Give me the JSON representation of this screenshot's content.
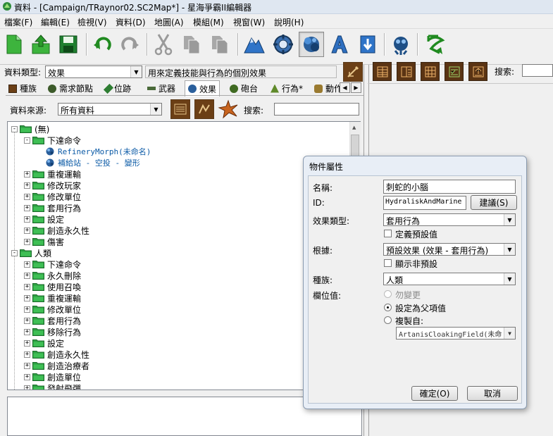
{
  "window": {
    "title": "資料 - [Campaign/TRaynor02.SC2Map*] - 星海爭霸II編輯器"
  },
  "menu": [
    "檔案(F)",
    "編輯(E)",
    "檢視(V)",
    "資料(D)",
    "地圖(A)",
    "模組(M)",
    "視窗(W)",
    "說明(H)"
  ],
  "toolbar": {
    "icons": [
      "new-file-icon",
      "open-upload-icon",
      "save-icon",
      "undo-icon",
      "redo-icon",
      "cut-icon",
      "copy-icon",
      "paste-icon",
      "terrain-editor-icon",
      "trigger-editor-icon",
      "data-editor-icon",
      "text-editor-icon",
      "import-icon",
      "ai-editor-icon",
      "test-map-icon"
    ]
  },
  "data_type": {
    "label": "資料類型:",
    "value": "效果",
    "description": "用來定義技能與行為的個別效果"
  },
  "tabs": [
    {
      "label": "種族",
      "icon": "race-icon"
    },
    {
      "label": "需求節點",
      "icon": "requirement-node-icon"
    },
    {
      "label": "位跡",
      "icon": "footprint-icon"
    },
    {
      "label": "武器",
      "icon": "weapon-icon"
    },
    {
      "label": "效果",
      "icon": "effect-icon"
    },
    {
      "label": "砲台",
      "icon": "turret-icon"
    },
    {
      "label": "行為*",
      "icon": "behavior-icon"
    },
    {
      "label": "動作",
      "icon": "actor-icon"
    }
  ],
  "data_source": {
    "label": "資料來源:",
    "value": "所有資料",
    "search_label": "搜索:"
  },
  "tree": [
    {
      "text": "(無)",
      "level": 0,
      "expander": "-",
      "type": "folder"
    },
    {
      "text": "下達命令",
      "level": 1,
      "expander": "-",
      "type": "folder"
    },
    {
      "text": "RefineryMorph(未命名)",
      "level": 2,
      "expander": "",
      "type": "leaf"
    },
    {
      "text": "補給站 - 空投 - 變形",
      "level": 2,
      "expander": "",
      "type": "leaf"
    },
    {
      "text": "重複運輸",
      "level": 1,
      "expander": "+",
      "type": "folder"
    },
    {
      "text": "修改玩家",
      "level": 1,
      "expander": "+",
      "type": "folder"
    },
    {
      "text": "修改單位",
      "level": 1,
      "expander": "+",
      "type": "folder"
    },
    {
      "text": "套用行為",
      "level": 1,
      "expander": "+",
      "type": "folder"
    },
    {
      "text": "設定",
      "level": 1,
      "expander": "+",
      "type": "folder"
    },
    {
      "text": "創造永久性",
      "level": 1,
      "expander": "+",
      "type": "folder"
    },
    {
      "text": "傷害",
      "level": 1,
      "expander": "+",
      "type": "folder"
    },
    {
      "text": "人類",
      "level": 0,
      "expander": "-",
      "type": "folder"
    },
    {
      "text": "下達命令",
      "level": 1,
      "expander": "+",
      "type": "folder"
    },
    {
      "text": "永久刪除",
      "level": 1,
      "expander": "+",
      "type": "folder"
    },
    {
      "text": "使用召喚",
      "level": 1,
      "expander": "+",
      "type": "folder"
    },
    {
      "text": "重複運輸",
      "level": 1,
      "expander": "+",
      "type": "folder"
    },
    {
      "text": "修改單位",
      "level": 1,
      "expander": "+",
      "type": "folder"
    },
    {
      "text": "套用行為",
      "level": 1,
      "expander": "+",
      "type": "folder"
    },
    {
      "text": "移除行為",
      "level": 1,
      "expander": "+",
      "type": "folder"
    },
    {
      "text": "設定",
      "level": 1,
      "expander": "+",
      "type": "folder"
    },
    {
      "text": "創造永久性",
      "level": 1,
      "expander": "+",
      "type": "folder"
    },
    {
      "text": "創造治療者",
      "level": 1,
      "expander": "+",
      "type": "folder"
    },
    {
      "text": "創造單位",
      "level": 1,
      "expander": "+",
      "type": "folder"
    },
    {
      "text": "發射飛彈",
      "level": 1,
      "expander": "+",
      "type": "folder"
    }
  ],
  "right_panel": {
    "search_label": "搜索:"
  },
  "dialog": {
    "title": "物件屬性",
    "name_label": "名稱:",
    "name_value": "刺蛇的小腦",
    "id_label": "ID:",
    "id_value": "HydraliskAndMarine",
    "suggest_button": "建議(S)",
    "effect_type_label": "效果類型:",
    "effect_type_value": "套用行為",
    "define_default_label": "定義預設值",
    "based_on_label": "根據:",
    "based_on_value": "預設效果 (效果 - 套用行為)",
    "show_non_default_label": "顯示非預設",
    "race_label": "種族:",
    "race_value": "人類",
    "field_values_label": "欄位值:",
    "radio_no_change": "勿變更",
    "radio_set_parent": "設定為父項值",
    "radio_copy_from": "複製自:",
    "copy_from_value": "ArtanisCloakingField(未命",
    "ok_button": "確定(O)",
    "cancel_button": "取消"
  }
}
